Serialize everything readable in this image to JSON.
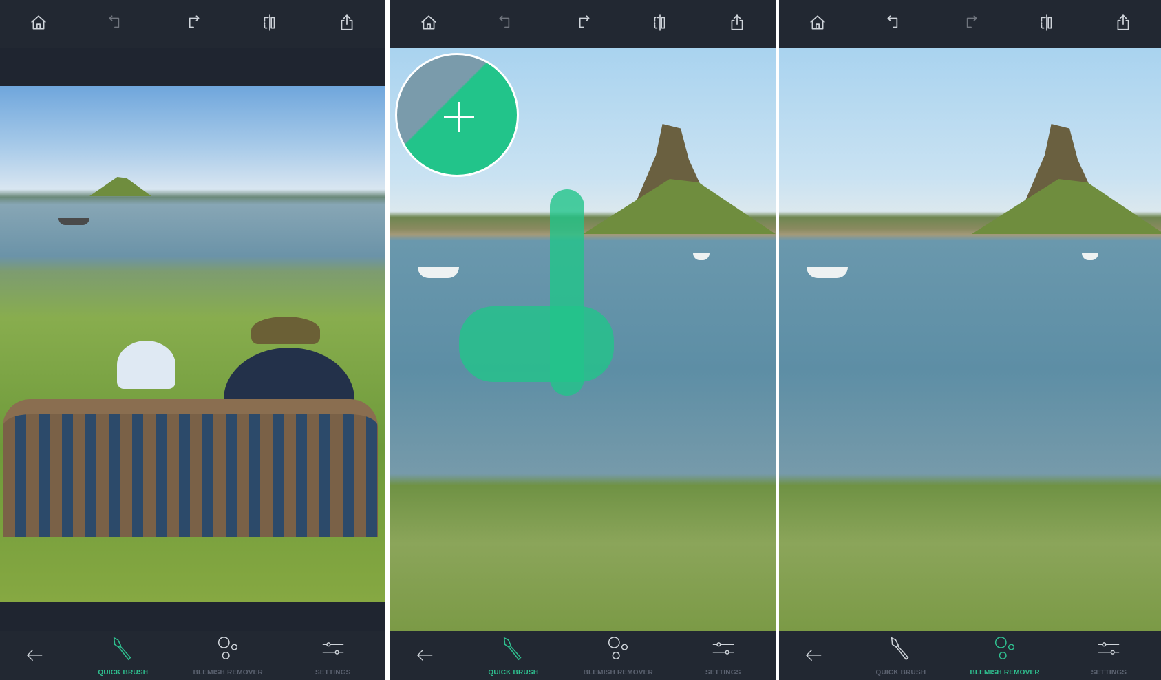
{
  "accent_color": "#2fbf8f",
  "toolbar": {
    "icons": [
      "home-icon",
      "undo-icon",
      "redo-icon",
      "compare-icon",
      "share-icon"
    ]
  },
  "bottom_nav": {
    "back_icon": "arrow-left-icon",
    "quick_brush": "QUICK BRUSH",
    "blemish_remover": "BLEMISH REMOVER",
    "settings": "SETTINGS"
  },
  "panels": [
    {
      "active_tool": "quick_brush",
      "undo_enabled": false,
      "redo_enabled": true
    },
    {
      "active_tool": "quick_brush",
      "undo_enabled": false,
      "redo_enabled": true
    },
    {
      "active_tool": "blemish_remover",
      "undo_enabled": true,
      "redo_enabled": false
    }
  ]
}
